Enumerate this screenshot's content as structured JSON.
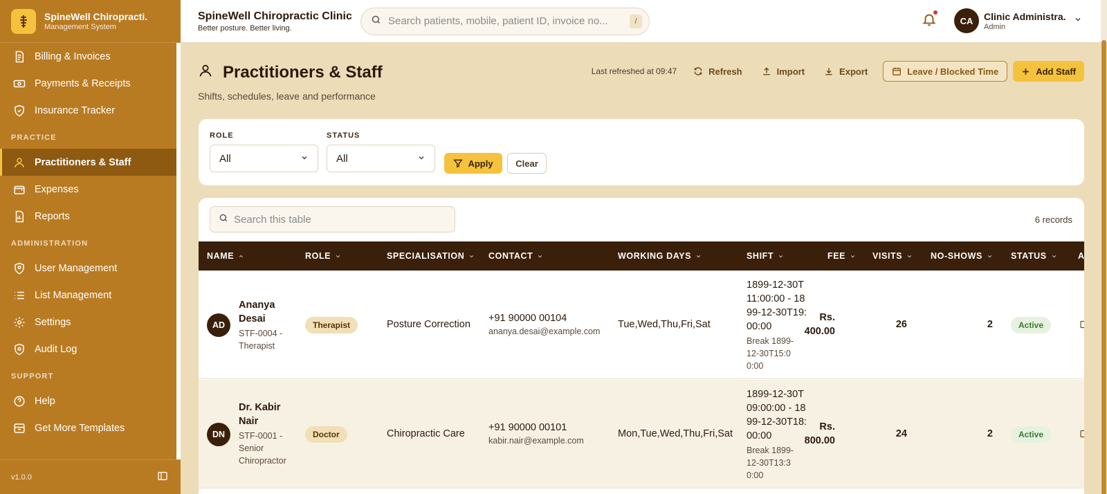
{
  "brand": {
    "name": "SpineWell Chiropracti.",
    "sub": "Management System"
  },
  "sidebar": {
    "items_top": [
      {
        "label": "Billing & Invoices",
        "icon": "invoice-icon"
      },
      {
        "label": "Payments & Receipts",
        "icon": "cash-icon"
      },
      {
        "label": "Insurance Tracker",
        "icon": "shield-check-icon"
      }
    ],
    "section_practice": "PRACTICE",
    "items_practice": [
      {
        "label": "Practitioners & Staff",
        "icon": "user-icon",
        "active": true
      },
      {
        "label": "Expenses",
        "icon": "wallet-icon"
      },
      {
        "label": "Reports",
        "icon": "report-icon"
      }
    ],
    "section_admin": "ADMINISTRATION",
    "items_admin": [
      {
        "label": "User Management",
        "icon": "shield-user-icon"
      },
      {
        "label": "List Management",
        "icon": "list-icon"
      },
      {
        "label": "Settings",
        "icon": "gear-icon"
      },
      {
        "label": "Audit Log",
        "icon": "shield-icon"
      }
    ],
    "section_support": "SUPPORT",
    "items_support": [
      {
        "label": "Help",
        "icon": "help-icon"
      },
      {
        "label": "Get More Templates",
        "icon": "store-icon"
      }
    ],
    "version": "v1.0.0"
  },
  "topbar": {
    "clinic_name": "SpineWell Chiropractic Clinic",
    "clinic_tagline": "Better posture. Better living.",
    "search_placeholder": "Search patients, mobile, patient ID, invoice no...",
    "search_shortcut": "/",
    "user_initials": "CA",
    "user_name": "Clinic Administra.",
    "user_role": "Admin"
  },
  "page": {
    "title": "Practitioners & Staff",
    "subtitle": "Shifts, schedules, leave and performance",
    "last_refreshed": "Last refreshed at 09:47",
    "actions": {
      "refresh": "Refresh",
      "import": "Import",
      "export": "Export",
      "leave": "Leave / Blocked Time",
      "add": "Add Staff"
    }
  },
  "filters": {
    "role_label": "ROLE",
    "role_value": "All",
    "status_label": "STATUS",
    "status_value": "All",
    "apply": "Apply",
    "clear": "Clear"
  },
  "table": {
    "search_placeholder": "Search this table",
    "records": "6 records",
    "columns": [
      "NAME",
      "ROLE",
      "SPECIALISATION",
      "CONTACT",
      "WORKING DAYS",
      "SHIFT",
      "FEE",
      "VISITS",
      "NO-SHOWS",
      "STATUS",
      "A"
    ],
    "rows": [
      {
        "initials": "AD",
        "name": "Ananya Desai",
        "meta": "STF-0004 - Therapist",
        "role": "Therapist",
        "specialisation": "Posture Correction",
        "phone": "+91 90000 00104",
        "email": "ananya.desai@example.com",
        "days": "Tue,Wed,Thu,Fri,Sat",
        "shift": "1899-12-30T11:00:00 - 1899-12-30T19:00:00",
        "break": "Break 1899-12-30T15:00:00",
        "fee": "Rs. 400.00",
        "visits": "26",
        "no_shows": "2",
        "status": "Active"
      },
      {
        "initials": "DN",
        "name": "Dr. Kabir Nair",
        "meta": "STF-0001 - Senior Chiropractor",
        "role": "Doctor",
        "specialisation": "Chiropractic Care",
        "phone": "+91 90000 00101",
        "email": "kabir.nair@example.com",
        "days": "Mon,Tue,Wed,Thu,Fri,Sat",
        "shift": "1899-12-30T09:00:00 - 1899-12-30T18:00:00",
        "break": "Break 1899-12-30T13:30:00",
        "fee": "Rs. 800.00",
        "visits": "24",
        "no_shows": "2",
        "status": "Active"
      }
    ]
  },
  "colors": {
    "sidebar": "#b97b22",
    "accent": "#f5c23d",
    "header_dark": "#3a1f0a",
    "active_bg": "#8e5a12"
  }
}
